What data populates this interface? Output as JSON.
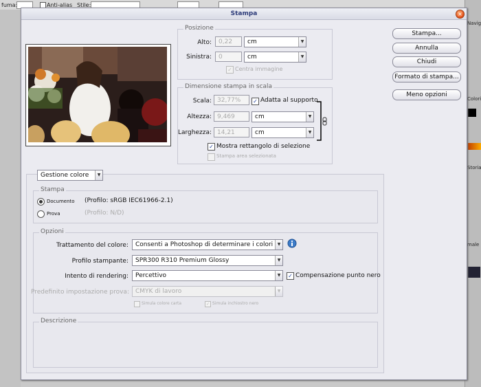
{
  "background": {
    "tool_label": "fuma:",
    "antialias_label": "Anti-alias",
    "stile_label": "Stile:",
    "navigator_tab": "Navig",
    "colors_tab": "Colori",
    "history_tab": "Storia",
    "normal_label": "male"
  },
  "dialog": {
    "title": "Stampa",
    "buttons": {
      "print": "Stampa...",
      "cancel": "Annulla",
      "close": "Chiudi",
      "page_setup": "Formato di stampa...",
      "fewer_options": "Meno opzioni"
    },
    "position": {
      "title": "Posizione",
      "top_label": "Alto:",
      "top_value": "0,22",
      "top_unit": "cm",
      "left_label": "Sinistra:",
      "left_value": "0",
      "left_unit": "cm",
      "center_label": "Centra immagine"
    },
    "scaled": {
      "title": "Dimensione stampa in scala",
      "scale_label": "Scala:",
      "scale_value": "32,77%",
      "fit_label": "Adatta al supporto",
      "height_label": "Altezza:",
      "height_value": "9,469",
      "height_unit": "cm",
      "width_label": "Larghezza:",
      "width_value": "14,21",
      "width_unit": "cm",
      "bbox_label": "Mostra rettangolo di selezione",
      "selection_label": "Stampa area selezionata"
    },
    "section_select": "Gestione colore",
    "stampa": {
      "title": "Stampa",
      "document_label": "Documento",
      "document_profile": "(Profilo: sRGB IEC61966-2.1)",
      "proof_label": "Prova",
      "proof_profile": "(Profilo: N/D)"
    },
    "options": {
      "title": "Opzioni",
      "color_handling_label": "Trattamento del colore:",
      "color_handling_value": "Consenti a Photoshop di determinare i colori",
      "printer_profile_label": "Profilo stampante:",
      "printer_profile_value": "SPR300 R310 Premium Glossy",
      "rendering_label": "Intento di rendering:",
      "rendering_value": "Percettivo",
      "bpc_label": "Compensazione punto nero",
      "proof_setup_label": "Predefinito impostazione prova:",
      "proof_setup_value": "CMYK di lavoro",
      "paper_label": "Simula colore carta",
      "ink_label": "Simula inchiostro nero"
    },
    "description": {
      "title": "Descrizione"
    }
  },
  "colors": {
    "title_text": "#2b3a78",
    "accent": "#1a3c9a"
  },
  "icons": {
    "info": "info-icon",
    "chain": "chain-link-icon",
    "close": "close-icon"
  }
}
